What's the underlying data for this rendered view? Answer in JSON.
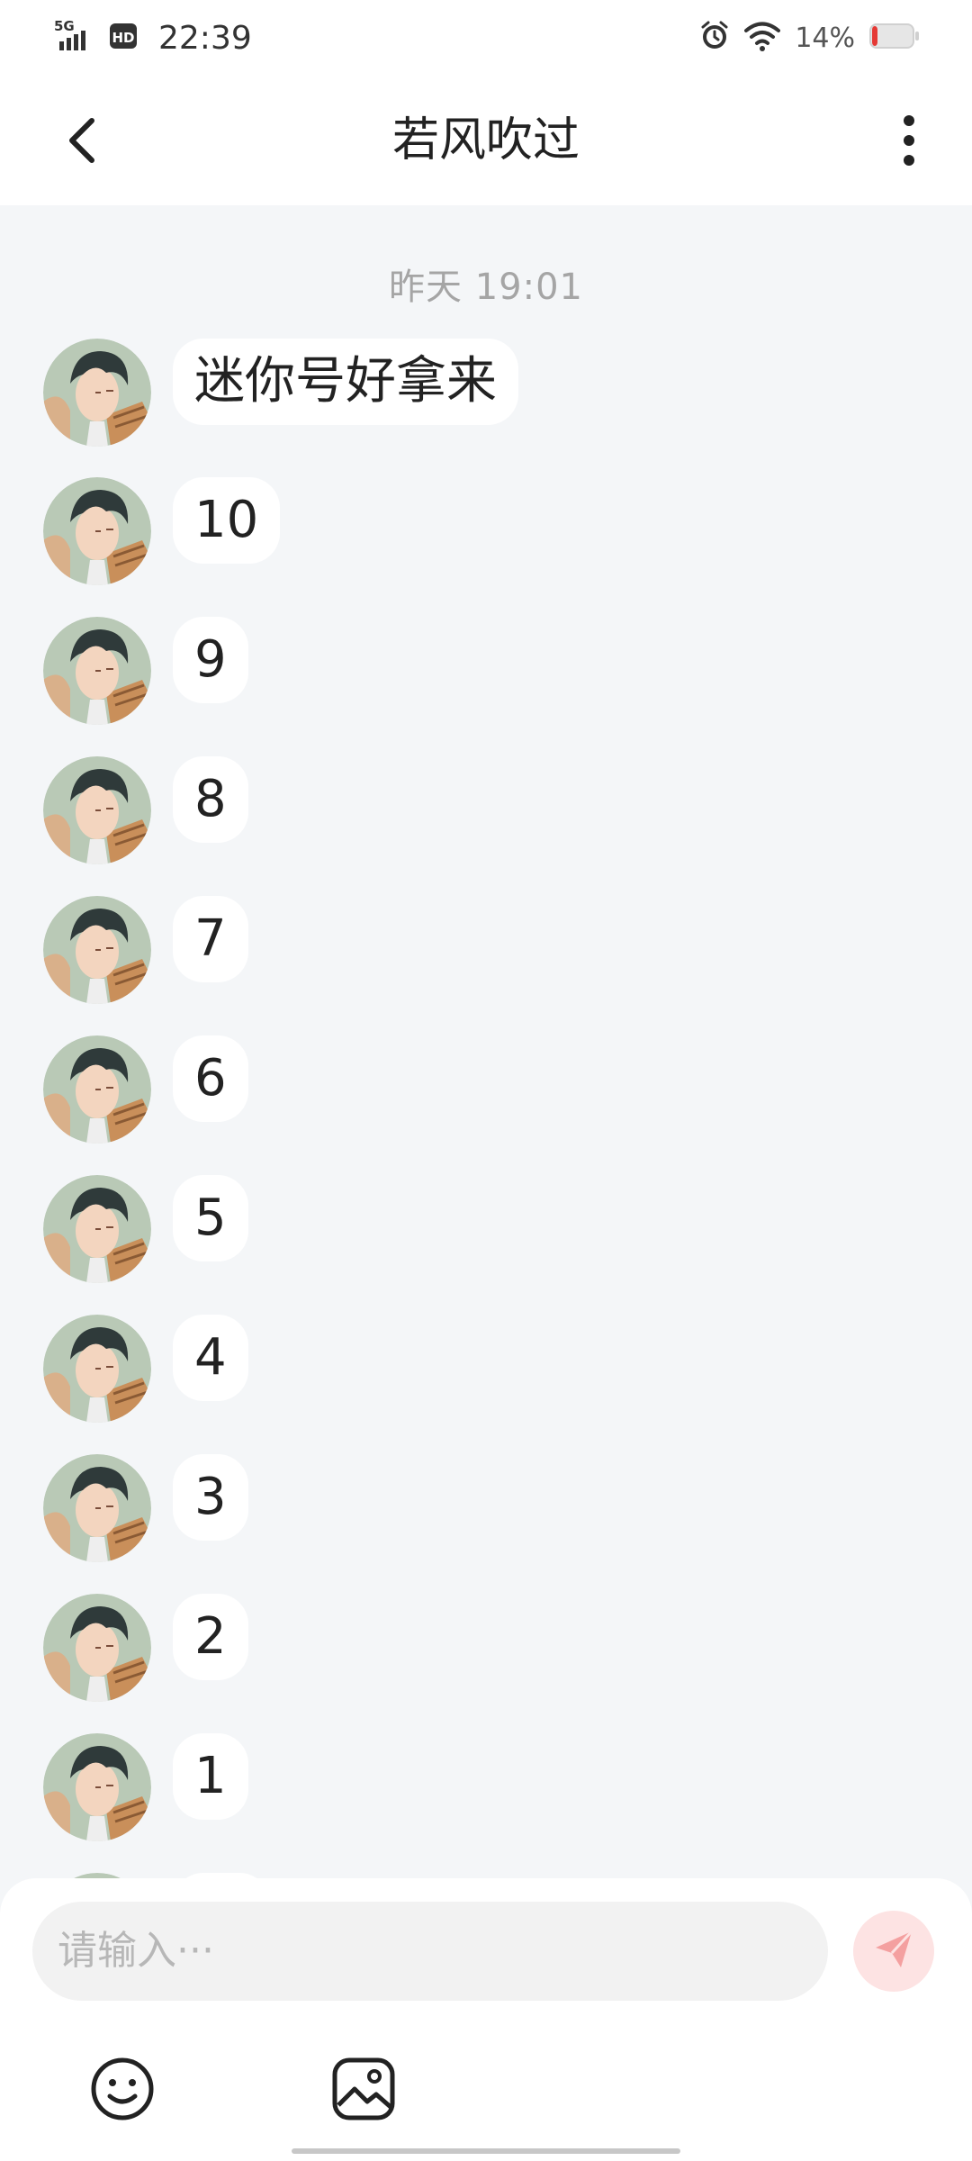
{
  "status_bar": {
    "network": "5G",
    "hd_badge": "HD",
    "time": "22:39",
    "battery_percent": "14%",
    "battery_level": 0.14,
    "icons": [
      "signal-icon",
      "hd-icon",
      "alarm-icon",
      "wifi-icon",
      "battery-icon"
    ]
  },
  "header": {
    "back_icon": "back-chevron-icon",
    "title": "若风吹过",
    "more_icon": "more-vertical-icon"
  },
  "chat": {
    "timestamp": "昨天  19:01",
    "messages": [
      {
        "text": "迷你号好拿来"
      },
      {
        "text": "10"
      },
      {
        "text": "9"
      },
      {
        "text": "8"
      },
      {
        "text": "7"
      },
      {
        "text": "6"
      },
      {
        "text": "5"
      },
      {
        "text": "4"
      },
      {
        "text": "3"
      },
      {
        "text": "2"
      },
      {
        "text": "1"
      }
    ]
  },
  "composer": {
    "placeholder": "请输入···",
    "send_icon": "send-icon",
    "tools": [
      "emoji-icon",
      "image-icon"
    ]
  },
  "colors": {
    "background": "#f4f6f8",
    "bubble": "#ffffff",
    "send_button": "#fde3e3",
    "send_icon": "#f4a0a0",
    "battery_low": "#e53935"
  }
}
